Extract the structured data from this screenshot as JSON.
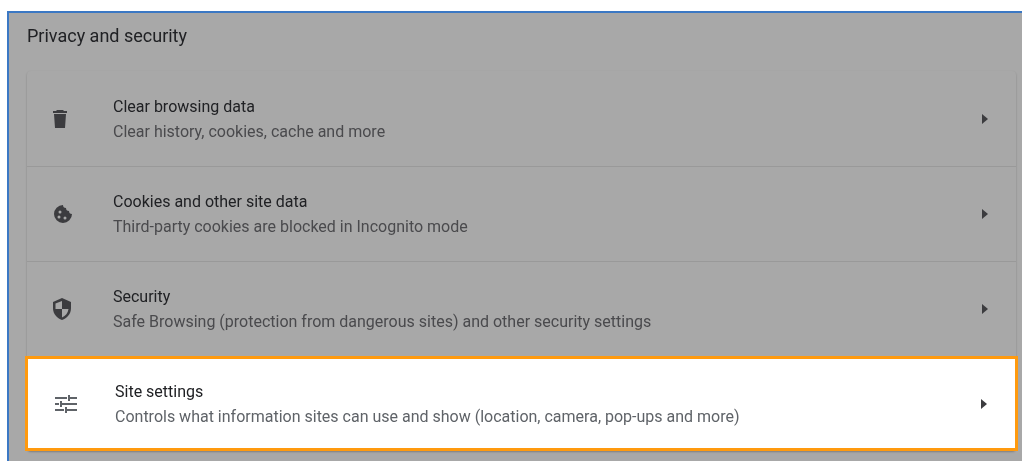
{
  "section": {
    "title": "Privacy and security"
  },
  "rows": [
    {
      "title": "Clear browsing data",
      "subtitle": "Clear history, cookies, cache and more",
      "selected": false
    },
    {
      "title": "Cookies and other site data",
      "subtitle": "Third-party cookies are blocked in Incognito mode",
      "selected": false
    },
    {
      "title": "Security",
      "subtitle": "Safe Browsing (protection from dangerous sites) and other security settings",
      "selected": false
    },
    {
      "title": "Site settings",
      "subtitle": "Controls what information sites can use and show (location, camera, pop-ups and more)",
      "selected": true
    }
  ]
}
